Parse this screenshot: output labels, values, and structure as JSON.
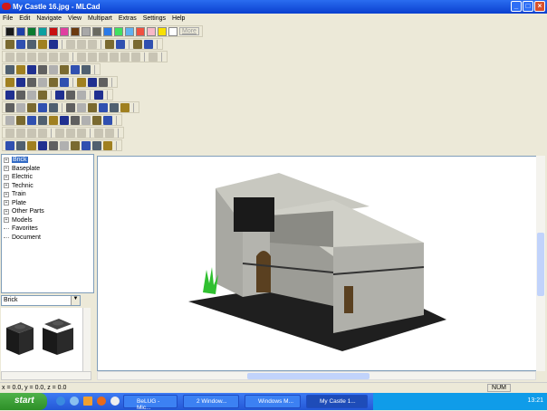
{
  "window": {
    "title": "My Castle 16.jpg - MLCad",
    "controls": [
      "_",
      "□",
      "×"
    ]
  },
  "menu": [
    "File",
    "Edit",
    "Navigate",
    "View",
    "Multipart",
    "Extras",
    "Settings",
    "Help"
  ],
  "colors": [
    "#1a1a1a",
    "#1e3fa8",
    "#0a7a2e",
    "#0aa0a0",
    "#c81010",
    "#e040a0",
    "#6b3a10",
    "#a8a8a8",
    "#6a6a60",
    "#2a7ae8",
    "#40e060",
    "#60b0f0",
    "#f05040",
    "#f8b8c8",
    "#f8e000",
    "#ffffff"
  ],
  "more_label": "More",
  "tree": {
    "items": [
      {
        "label": "Brick",
        "expander": "+",
        "selected": true
      },
      {
        "label": "Baseplate",
        "expander": "+"
      },
      {
        "label": "Electric",
        "expander": "+"
      },
      {
        "label": "Technic",
        "expander": "+"
      },
      {
        "label": "Train",
        "expander": "+"
      },
      {
        "label": "Plate",
        "expander": "+"
      },
      {
        "label": "Other Parts",
        "expander": "+"
      },
      {
        "label": "Models",
        "expander": "+"
      },
      {
        "label": "Favorites",
        "expander": ""
      },
      {
        "label": "Document",
        "expander": ""
      }
    ]
  },
  "category_select": {
    "value": "Brick"
  },
  "status": {
    "coords": "x = 0.0, y = 0.0, z = 0.0",
    "num": "NUM"
  },
  "taskbar": {
    "start": "start",
    "tasks": [
      "BeLUG - Mic...",
      "2 Window...",
      "Windows M...",
      "My Castle 1..."
    ],
    "clock": "13:21"
  }
}
